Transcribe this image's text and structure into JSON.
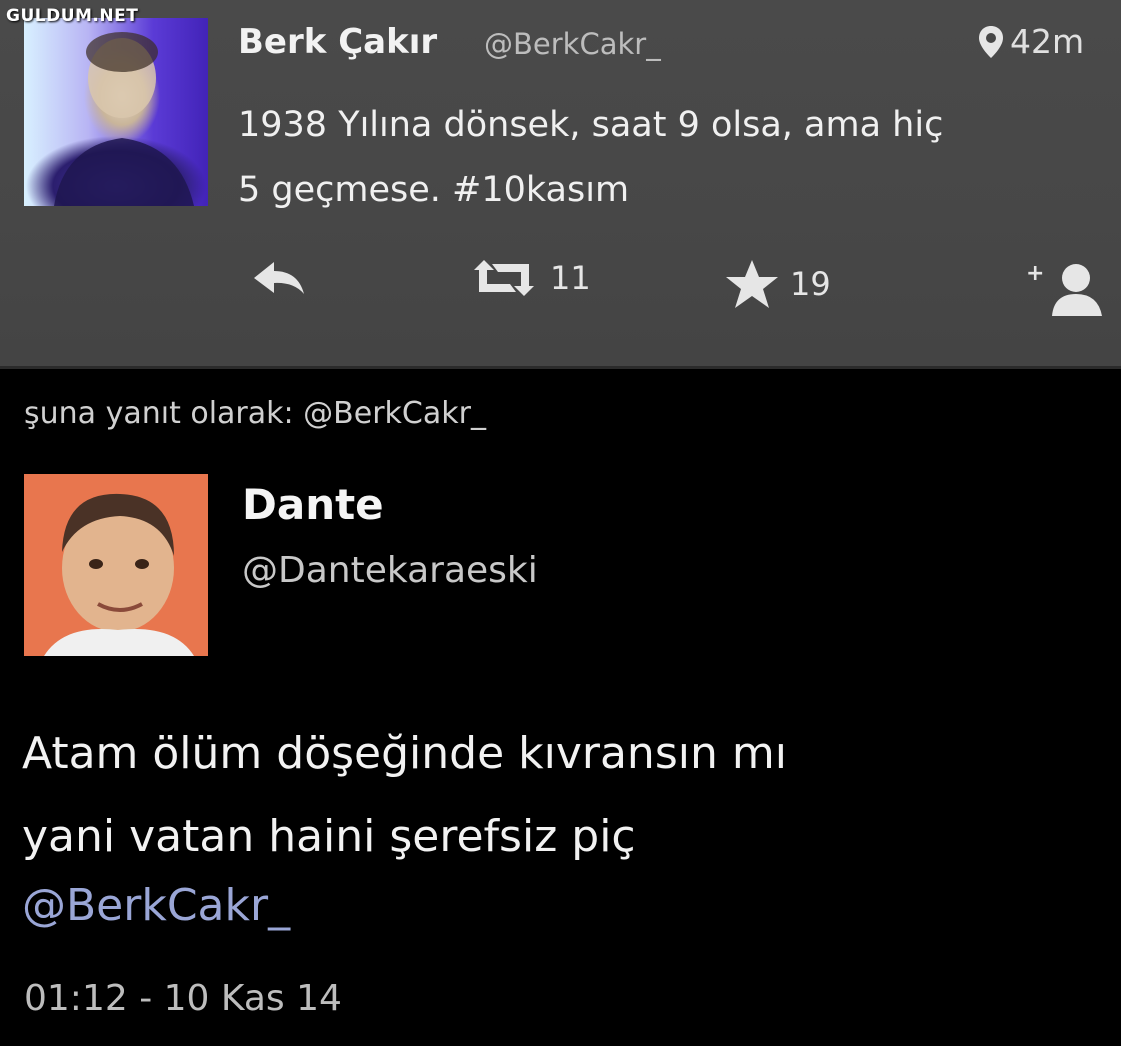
{
  "watermark": "GULDUM.NET",
  "tweet1": {
    "author": "Berk Çakır",
    "handle": "@BerkCakr_",
    "location_icon": "location-pin-icon",
    "location": "42m",
    "text_line1": "1938 Yılına dönsek, saat 9 olsa, ama hiç",
    "text_line2": "5 geçmese. #10kasım",
    "actions": {
      "reply_icon": "reply-icon",
      "retweet_icon": "retweet-icon",
      "retweet_count": "11",
      "favorite_icon": "star-icon",
      "favorite_count": "19",
      "follow_icon": "add-user-icon"
    }
  },
  "reply_context": "şuna yanıt olarak: @BerkCakr_",
  "tweet2": {
    "author": "Dante",
    "handle": "@Dantekaraeski",
    "text_line1": "Atam ölüm döşeğinde kıvransın mı",
    "text_line2": "yani vatan haini şerefsiz piç",
    "mention": "@BerkCakr_",
    "timestamp": "01:12 - 10 Kas 14"
  },
  "colors": {
    "top_card_bg": "#474747",
    "page_bg": "#000000",
    "mention": "#9aa6d6"
  }
}
